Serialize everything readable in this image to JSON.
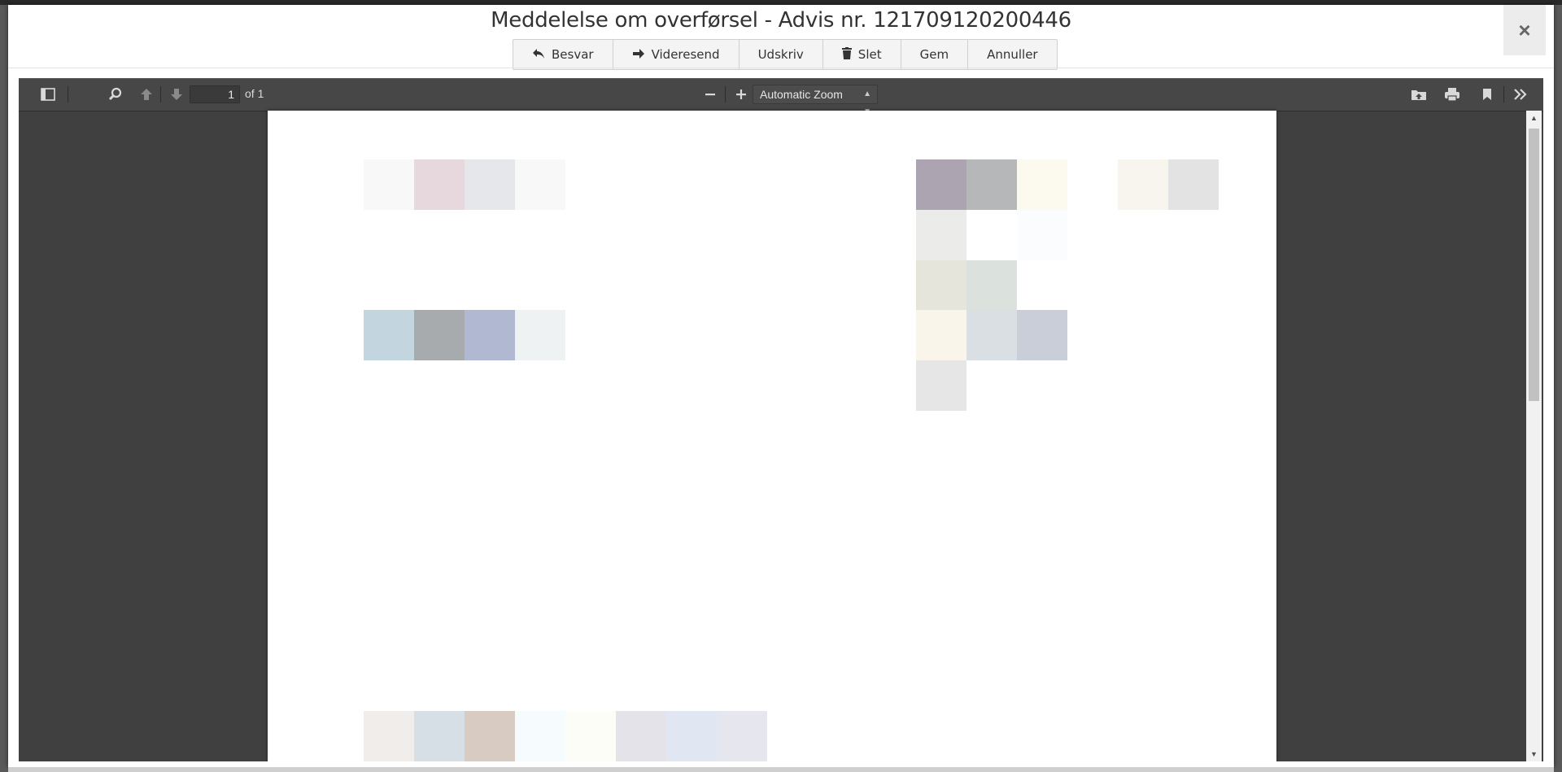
{
  "dialog": {
    "title": "Meddelelse om overførsel - Advis nr. 121709120200446",
    "close_label": "×"
  },
  "toolbar": {
    "buttons": [
      {
        "label": "Besvar",
        "icon": "reply-icon"
      },
      {
        "label": "Videresend",
        "icon": "forward-arrow-icon"
      },
      {
        "label": "Udskriv",
        "icon": ""
      },
      {
        "label": "Slet",
        "icon": "trash-icon"
      },
      {
        "label": "Gem",
        "icon": ""
      },
      {
        "label": "Annuller",
        "icon": ""
      }
    ]
  },
  "pdf_viewer": {
    "page_number": "1",
    "page_count_label": "of 1",
    "zoom_value": "Automatic Zoom",
    "tools": {
      "sidebar": "sidebar-toggle-icon",
      "find": "search-icon",
      "previous": "arrow-up-icon",
      "next": "arrow-down-icon",
      "zoom_out": "minus-icon",
      "zoom_in": "plus-icon",
      "open": "open-file-icon",
      "print": "print-icon",
      "bookmark": "bookmark-icon",
      "tools_menu": "double-chevron-right-icon"
    }
  },
  "colors": {
    "viewer_bg": "#404040",
    "toolbar_bg": "#474747",
    "page_bg": "#ffffff"
  }
}
